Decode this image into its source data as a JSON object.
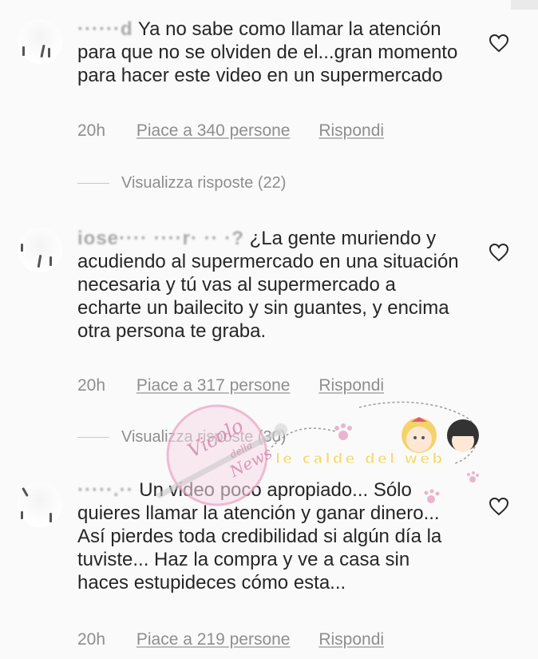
{
  "comments": [
    {
      "username": "······d",
      "text": "Ya no sabe como llamar la atención para que no se olviden de el...gran momento para hacer este video en un supermercado",
      "time": "20h",
      "likes": "Piace a 340 persone",
      "reply": "Rispondi",
      "replies": "Visualizza risposte (22)"
    },
    {
      "username": "iose···· ····r· ·· ·?",
      "text": "¿La gente muriendo y acudiendo al supermercado en una situación necesaria y tú vas al supermercado a echarte un bailecito y sin guantes, y encima otra persona te graba.",
      "time": "20h",
      "likes": "Piace a 317 persone",
      "reply": "Rispondi",
      "replies": "Visualizza risposte (30)"
    },
    {
      "username": "·····.··",
      "text": "Un video poco apropiado... Sólo quieres llamar la atención y ganar dinero... Así pierdes toda credibilidad si algún día la tuviste... Haz la compra y ve a casa sin haces estupideces cómo esta...",
      "time": "20h",
      "likes": "Piace a 219 persone",
      "reply": "Rispondi"
    }
  ],
  "watermarks": {
    "stamp_line1": "Vicolo",
    "stamp_line2": "della",
    "stamp_line3": "News",
    "banner": "le calde del web"
  },
  "icons": {
    "like": "heart-outline-icon"
  },
  "colors": {
    "text": "#262626",
    "meta": "#8e8e8e",
    "background": "#fafafa",
    "watermark_pink": "#e8a3c3",
    "watermark_yellow": "#f2d35a"
  }
}
